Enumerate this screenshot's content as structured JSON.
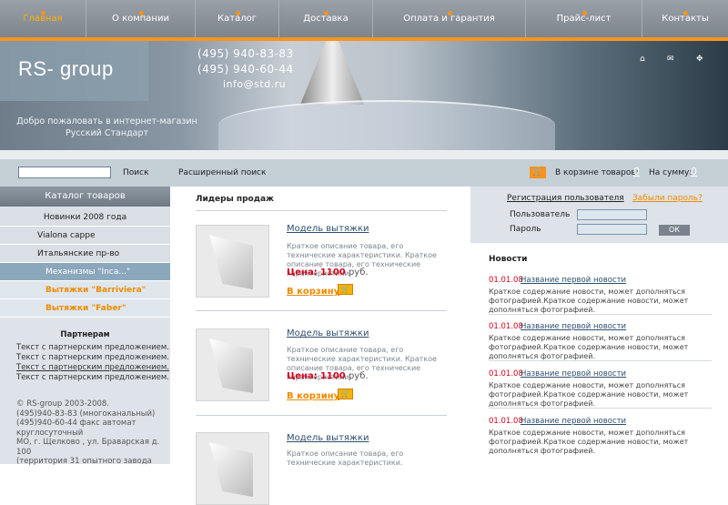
{
  "nav": {
    "items": [
      "Главная",
      "О компании",
      "Каталог",
      "Доставка",
      "Оплата и гарантия",
      "Прайс-лист",
      "Контакты"
    ]
  },
  "header": {
    "logo": "RS- group",
    "phone1": "(495) 940-83-83",
    "phone2": "(495) 940-60-44",
    "email": "info@std.ru",
    "welcome_line1": "Добро пожаловать в интернет-магазин",
    "welcome_line2": "Русский Стандарт"
  },
  "search": {
    "button": "Поиск",
    "advanced": "Расширенный поиск",
    "cart_items_label": "В корзине товаров:",
    "cart_items": "0",
    "cart_sum_label": "На сумму:",
    "cart_sum": "0"
  },
  "catalog": {
    "title": "Каталог товаров",
    "items": [
      "Новинки 2008 года",
      "Vialona cappe",
      "Итальянские пр-во",
      "Механизмы \"Inca...\"",
      "Вытяжки \"Barriviera\"",
      "Вытяжки \"Faber\""
    ]
  },
  "partners": {
    "title": "Партнерам",
    "lines": [
      "Текст с партнерским предложением.",
      "Текст с партнерским предложением.",
      "Текст с партнерским предложением.",
      "Текст с партнерским предложением."
    ]
  },
  "footer": {
    "lines": [
      "© RS-group 2003-2008.",
      "(495)940-83-83 (многоканальный)",
      "(495)940-60-44 факс автомат",
      "круглосуточный",
      "МО, г. Щелково , ул. Браварская д.",
      "100",
      "(территория 31 опытного завода"
    ]
  },
  "center": {
    "title": "Лидеры продаж",
    "products": [
      {
        "name": "Модель вытяжки",
        "desc": "Краткое описание товара, его технические характеристики. Краткое описание товара, его технические характеристики.",
        "price_label": "Цена:",
        "price": "1100",
        "currency": "руб.",
        "cart": "В корзину"
      },
      {
        "name": "Модель вытяжки",
        "desc": "Краткое описание товара, его технические характеристики. Краткое описание товара, его технические характеристики.",
        "price_label": "Цена:",
        "price": "1100",
        "currency": "руб.",
        "cart": "В корзину"
      },
      {
        "name": "Модель вытяжки",
        "desc": "Краткое описание товара, его технические характеристики."
      }
    ]
  },
  "login": {
    "register": "Регистрация пользователя",
    "forgot": "Забыли пароль?",
    "user_label": "Пользователь",
    "pass_label": "Пароль",
    "ok": "ОК"
  },
  "news": {
    "title": "Новости",
    "items": [
      {
        "date": "01.01.08",
        "title": "Название первой новости",
        "text": "Краткое содержание новости, может дополняться фотографией.Краткое содержание новости, может дополняться фотографией."
      },
      {
        "date": "01.01.08",
        "title": "Название первой новости",
        "text": "Краткое содержание новости, может дополняться фотографией.Краткое содержание новости, может дополняться фотографией."
      },
      {
        "date": "01.01.08",
        "title": "Название первой новости",
        "text": "Краткое содержание новости, может дополняться фотографией.Краткое содержание новости, может дополняться фотографией."
      },
      {
        "date": "01.01.08",
        "title": "Название первой новости",
        "text": "Краткое содержание новости, может дополняться фотографией.Краткое содержание новости, может дополняться фотографией."
      }
    ]
  },
  "colors": {
    "accent": "#f7941d",
    "price": "#d0021b",
    "link": "#2d4f6e"
  }
}
